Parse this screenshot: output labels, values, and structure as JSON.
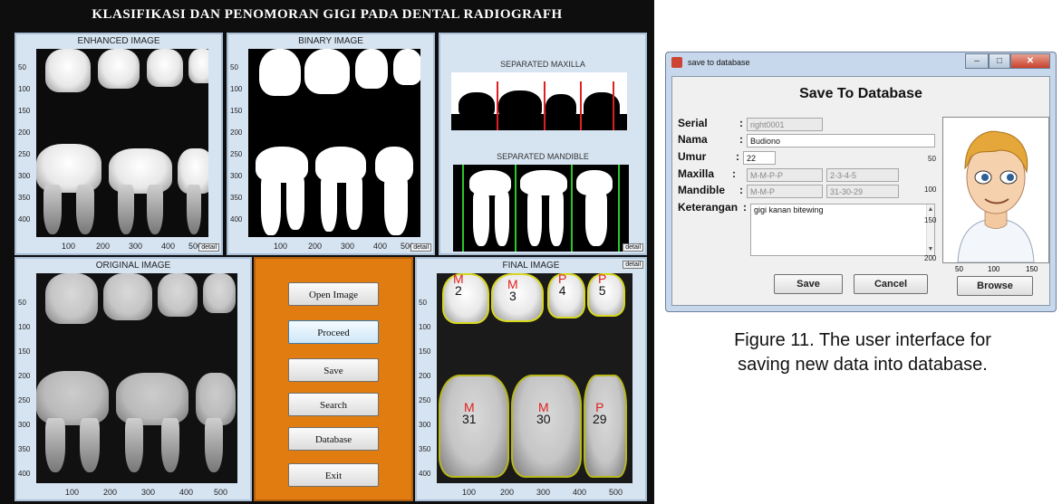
{
  "app": {
    "title": "KLASIFIKASI DAN PENOMORAN GIGI PADA DENTAL RADIOGRAFH",
    "panels": {
      "enhanced": {
        "title": "ENHANCED IMAGE",
        "yticks": [
          "50",
          "100",
          "150",
          "200",
          "250",
          "300",
          "350",
          "400"
        ],
        "xticks": [
          "100",
          "200",
          "300",
          "400",
          "500"
        ],
        "detail": "detail"
      },
      "binary": {
        "title": "BINARY IMAGE",
        "yticks": [
          "50",
          "100",
          "150",
          "200",
          "250",
          "300",
          "350",
          "400"
        ],
        "xticks": [
          "100",
          "200",
          "300",
          "400",
          "500"
        ],
        "detail": "detail"
      },
      "separated": {
        "maxilla_title": "SEPARATED MAXILLA",
        "mandible_title": "SEPARATED MANDIBLE",
        "detail": "detail"
      },
      "original": {
        "title": "ORIGINAL IMAGE",
        "yticks": [
          "50",
          "100",
          "150",
          "200",
          "250",
          "300",
          "350",
          "400"
        ],
        "xticks": [
          "100",
          "200",
          "300",
          "400",
          "500"
        ]
      },
      "final": {
        "title": "FINAL IMAGE",
        "detail": "detail",
        "yticks": [
          "50",
          "100",
          "150",
          "200",
          "250",
          "300",
          "350",
          "400"
        ],
        "xticks": [
          "100",
          "200",
          "300",
          "400",
          "500"
        ],
        "upper_labels": [
          {
            "cls": "M",
            "num": "2"
          },
          {
            "cls": "M",
            "num": "3"
          },
          {
            "cls": "P",
            "num": "4"
          },
          {
            "cls": "P",
            "num": "5"
          }
        ],
        "lower_labels": [
          {
            "cls": "M",
            "num": "31"
          },
          {
            "cls": "M",
            "num": "30"
          },
          {
            "cls": "P",
            "num": "29"
          }
        ]
      }
    },
    "buttons": {
      "open": "Open Image",
      "proceed": "Proceed",
      "save": "Save",
      "search": "Search",
      "database": "Database",
      "exit": "Exit"
    }
  },
  "dialog": {
    "window_title": "save to database",
    "heading": "Save To Database",
    "fields": {
      "serial": {
        "label": "Serial",
        "value": "right0001"
      },
      "nama": {
        "label": "Nama",
        "value": "Budiono"
      },
      "umur": {
        "label": "Umur",
        "value": "22"
      },
      "maxilla": {
        "label": "Maxilla",
        "value_class": "M-M-P-P",
        "value_num": "2-3-4-5"
      },
      "mandible": {
        "label": "Mandible",
        "value_class": "M-M-P",
        "value_num": "31-30-29"
      },
      "keterangan": {
        "label": "Keterangan",
        "value": "gigi kanan bitewing"
      }
    },
    "photo_axis": {
      "yticks": [
        "50",
        "100",
        "150",
        "200"
      ],
      "xticks": [
        "50",
        "100",
        "150"
      ]
    },
    "buttons": {
      "save": "Save",
      "cancel": "Cancel",
      "browse": "Browse"
    }
  },
  "caption": {
    "line1": "Figure 11. The user interface for",
    "line2": "saving new data into database."
  },
  "colors": {
    "button_panel": "#e07c10",
    "panel_bg": "#d6e4f2",
    "label_red": "#e02020",
    "contour_yellow": "#d8d820",
    "separator_red": "#e02020",
    "separator_green": "#28c828"
  }
}
